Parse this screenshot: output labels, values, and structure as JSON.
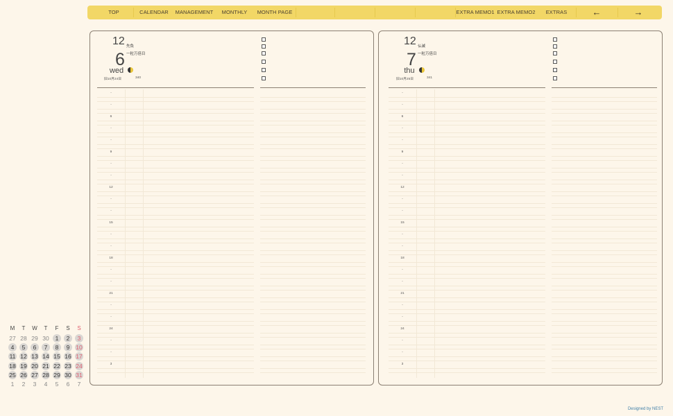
{
  "nav": {
    "top": "TOP",
    "calendar": "CALENDAR",
    "management": "MANAGEMENT",
    "monthly": "MONTHLY",
    "month_page": "MONTH PAGE",
    "extra_memo1": "EXTRA MEMO1",
    "extra_memo2": "EXTRA MEMO2",
    "extras": "EXTRAS",
    "prev": "←",
    "next": "→"
  },
  "pages": [
    {
      "month": "12",
      "day": "6",
      "weekday": "wed",
      "rokuyo": "先負",
      "note": "一粒万倍日",
      "lunar": "旧10月24日",
      "day_of_year": "340"
    },
    {
      "month": "12",
      "day": "7",
      "weekday": "thu",
      "rokuyo": "仏滅",
      "note": "一粒万倍日",
      "lunar": "旧10月25日",
      "day_of_year": "341"
    }
  ],
  "hours": [
    "-",
    "-",
    "6",
    "-",
    "-",
    "9",
    "-",
    "-",
    "12",
    "-",
    "-",
    "15",
    "-",
    "-",
    "18",
    "-",
    "-",
    "21",
    "-",
    "-",
    "24",
    "-",
    "-",
    "3"
  ],
  "mini_calendar": {
    "headers": [
      "M",
      "T",
      "W",
      "T",
      "F",
      "S",
      "S"
    ],
    "weeks": [
      [
        "27",
        "28",
        "29",
        "30",
        "1",
        "2",
        "3"
      ],
      [
        "4",
        "5",
        "6",
        "7",
        "8",
        "9",
        "10"
      ],
      [
        "11",
        "12",
        "13",
        "14",
        "15",
        "16",
        "17"
      ],
      [
        "18",
        "19",
        "20",
        "21",
        "22",
        "23",
        "24"
      ],
      [
        "25",
        "26",
        "27",
        "28",
        "29",
        "30",
        "31"
      ],
      [
        "1",
        "2",
        "3",
        "4",
        "5",
        "6",
        "7"
      ]
    ]
  },
  "credit": "Designed by NEST",
  "colors": {
    "nav": "#f2d766",
    "background": "#fdf6ea",
    "sunday": "#e06070",
    "credit": "#3f7fa8"
  }
}
